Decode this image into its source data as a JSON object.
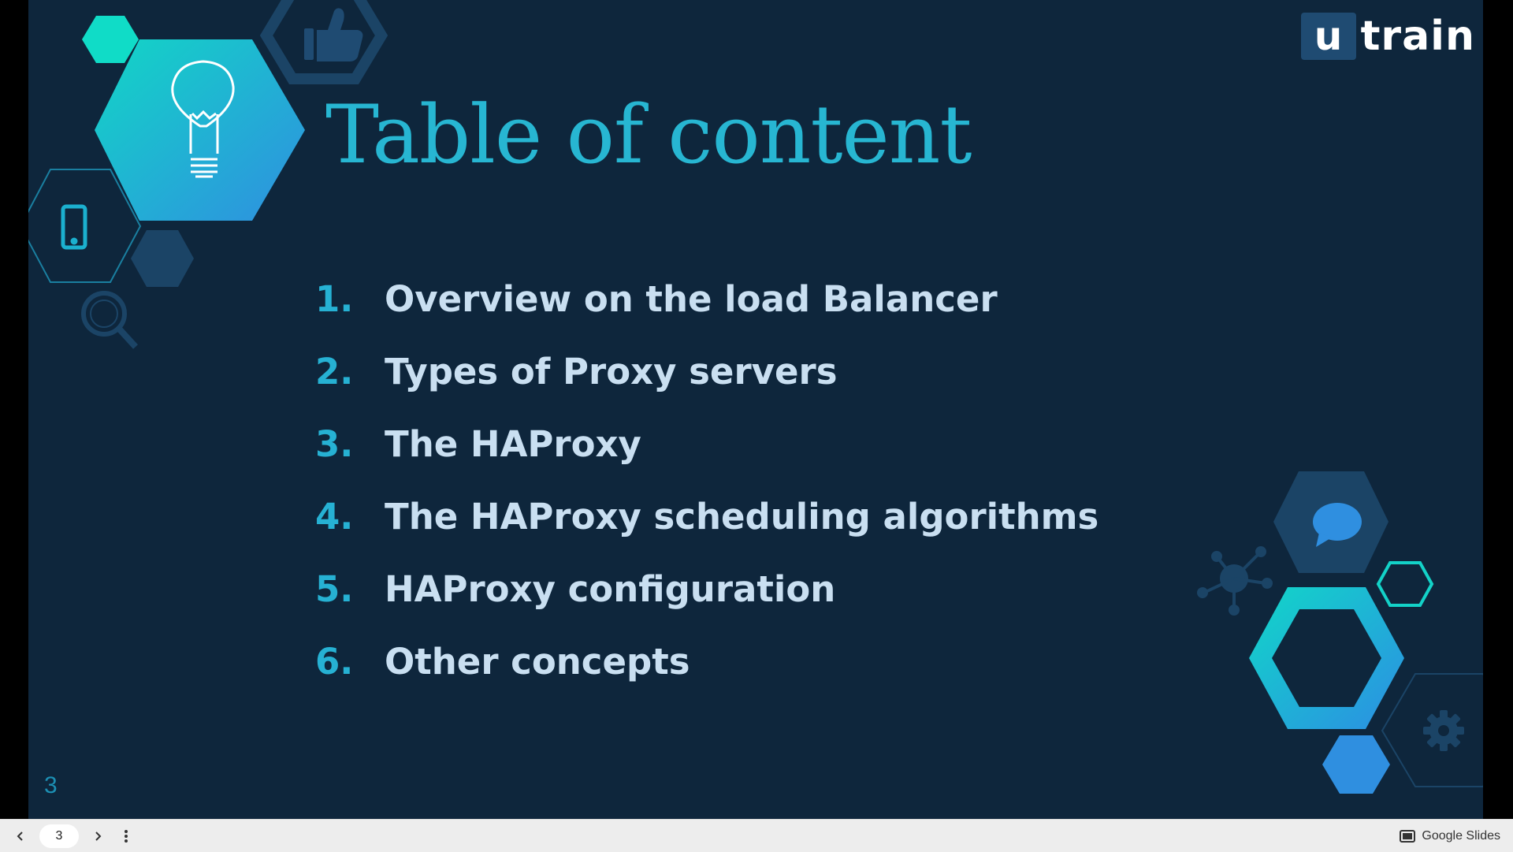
{
  "slide": {
    "title": "Table of content",
    "items": [
      {
        "number": "1.",
        "label": "Overview on the load Balancer"
      },
      {
        "number": "2.",
        "label": "Types of Proxy servers"
      },
      {
        "number": "3.",
        "label": "The HAProxy"
      },
      {
        "number": "4.",
        "label": "The HAProxy scheduling algorithms"
      },
      {
        "number": "5.",
        "label": "HAProxy configuration"
      },
      {
        "number": "6.",
        "label": "Other concepts"
      }
    ],
    "slide_number": "3",
    "logo": {
      "mark": "u",
      "text": "train"
    }
  },
  "toolbar": {
    "current_page": "3",
    "brand": "Google Slides"
  },
  "icons": [
    "lightbulb-icon",
    "thumbs-up-icon",
    "phone-icon",
    "magnifier-icon",
    "chat-bubble-icon",
    "network-icon",
    "gear-icon",
    "chevron-left-icon",
    "chevron-right-icon",
    "more-vert-icon",
    "slides-icon"
  ],
  "colors": {
    "background": "#0e263c",
    "accent": "#27b6d2",
    "item_text": "#c9dff1",
    "hex_dark": "#1b4466",
    "toolbar": "#ededed"
  }
}
